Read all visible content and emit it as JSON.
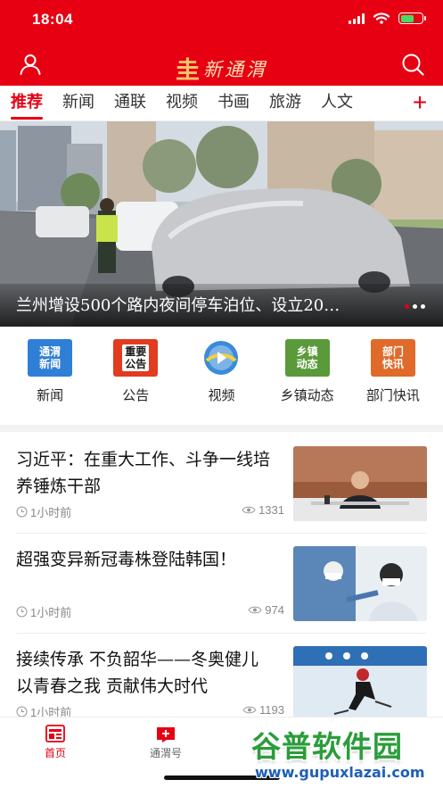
{
  "status_bar": {
    "time": "18:04"
  },
  "header": {
    "logo_mark": "圭",
    "logo_text": "新通渭",
    "user_icon": "user-icon",
    "search_icon": "search-icon"
  },
  "tabs": [
    {
      "label": "推荐",
      "active": true
    },
    {
      "label": "新闻"
    },
    {
      "label": "通联"
    },
    {
      "label": "视频"
    },
    {
      "label": "书画"
    },
    {
      "label": "旅游"
    },
    {
      "label": "人文"
    }
  ],
  "tab_add": "+",
  "banner": {
    "title": "兰州增设500个路内夜间停车泊位、设立20…",
    "slide_count": 3,
    "active_slide": 1
  },
  "quick_entries": [
    {
      "label": "新闻",
      "icon_text": "通渭新闻",
      "color": "#2f7fd6"
    },
    {
      "label": "公告",
      "icon_text": "重要公告",
      "color": "#e23b1f"
    },
    {
      "label": "视频",
      "icon_text": "",
      "color": "#3a8bd8"
    },
    {
      "label": "乡镇动态",
      "icon_text": "乡镇动态",
      "color": "#5a9a3a"
    },
    {
      "label": "部门快讯",
      "icon_text": "部门快讯",
      "color": "#e06a2a"
    }
  ],
  "news": [
    {
      "title": "习近平：在重大工作、斗争一线培养锤炼干部",
      "time": "1小时前",
      "views": "1331"
    },
    {
      "title": "超强变异新冠毒株登陆韩国！",
      "time": "1小时前",
      "views": "974"
    },
    {
      "title": "接续传承 不负韶华——冬奥健儿以青春之我 贡献伟大时代",
      "time": "1小时前",
      "views": "1193"
    }
  ],
  "bottom_nav": [
    {
      "label": "首页",
      "active": true
    },
    {
      "label": "通渭号"
    }
  ],
  "watermark": {
    "title": "谷普软件园",
    "url": "www.gupuxlazai.com"
  },
  "colors": {
    "brand_red": "#e60012",
    "tab_text": "#333333",
    "meta_gray": "#888888"
  }
}
